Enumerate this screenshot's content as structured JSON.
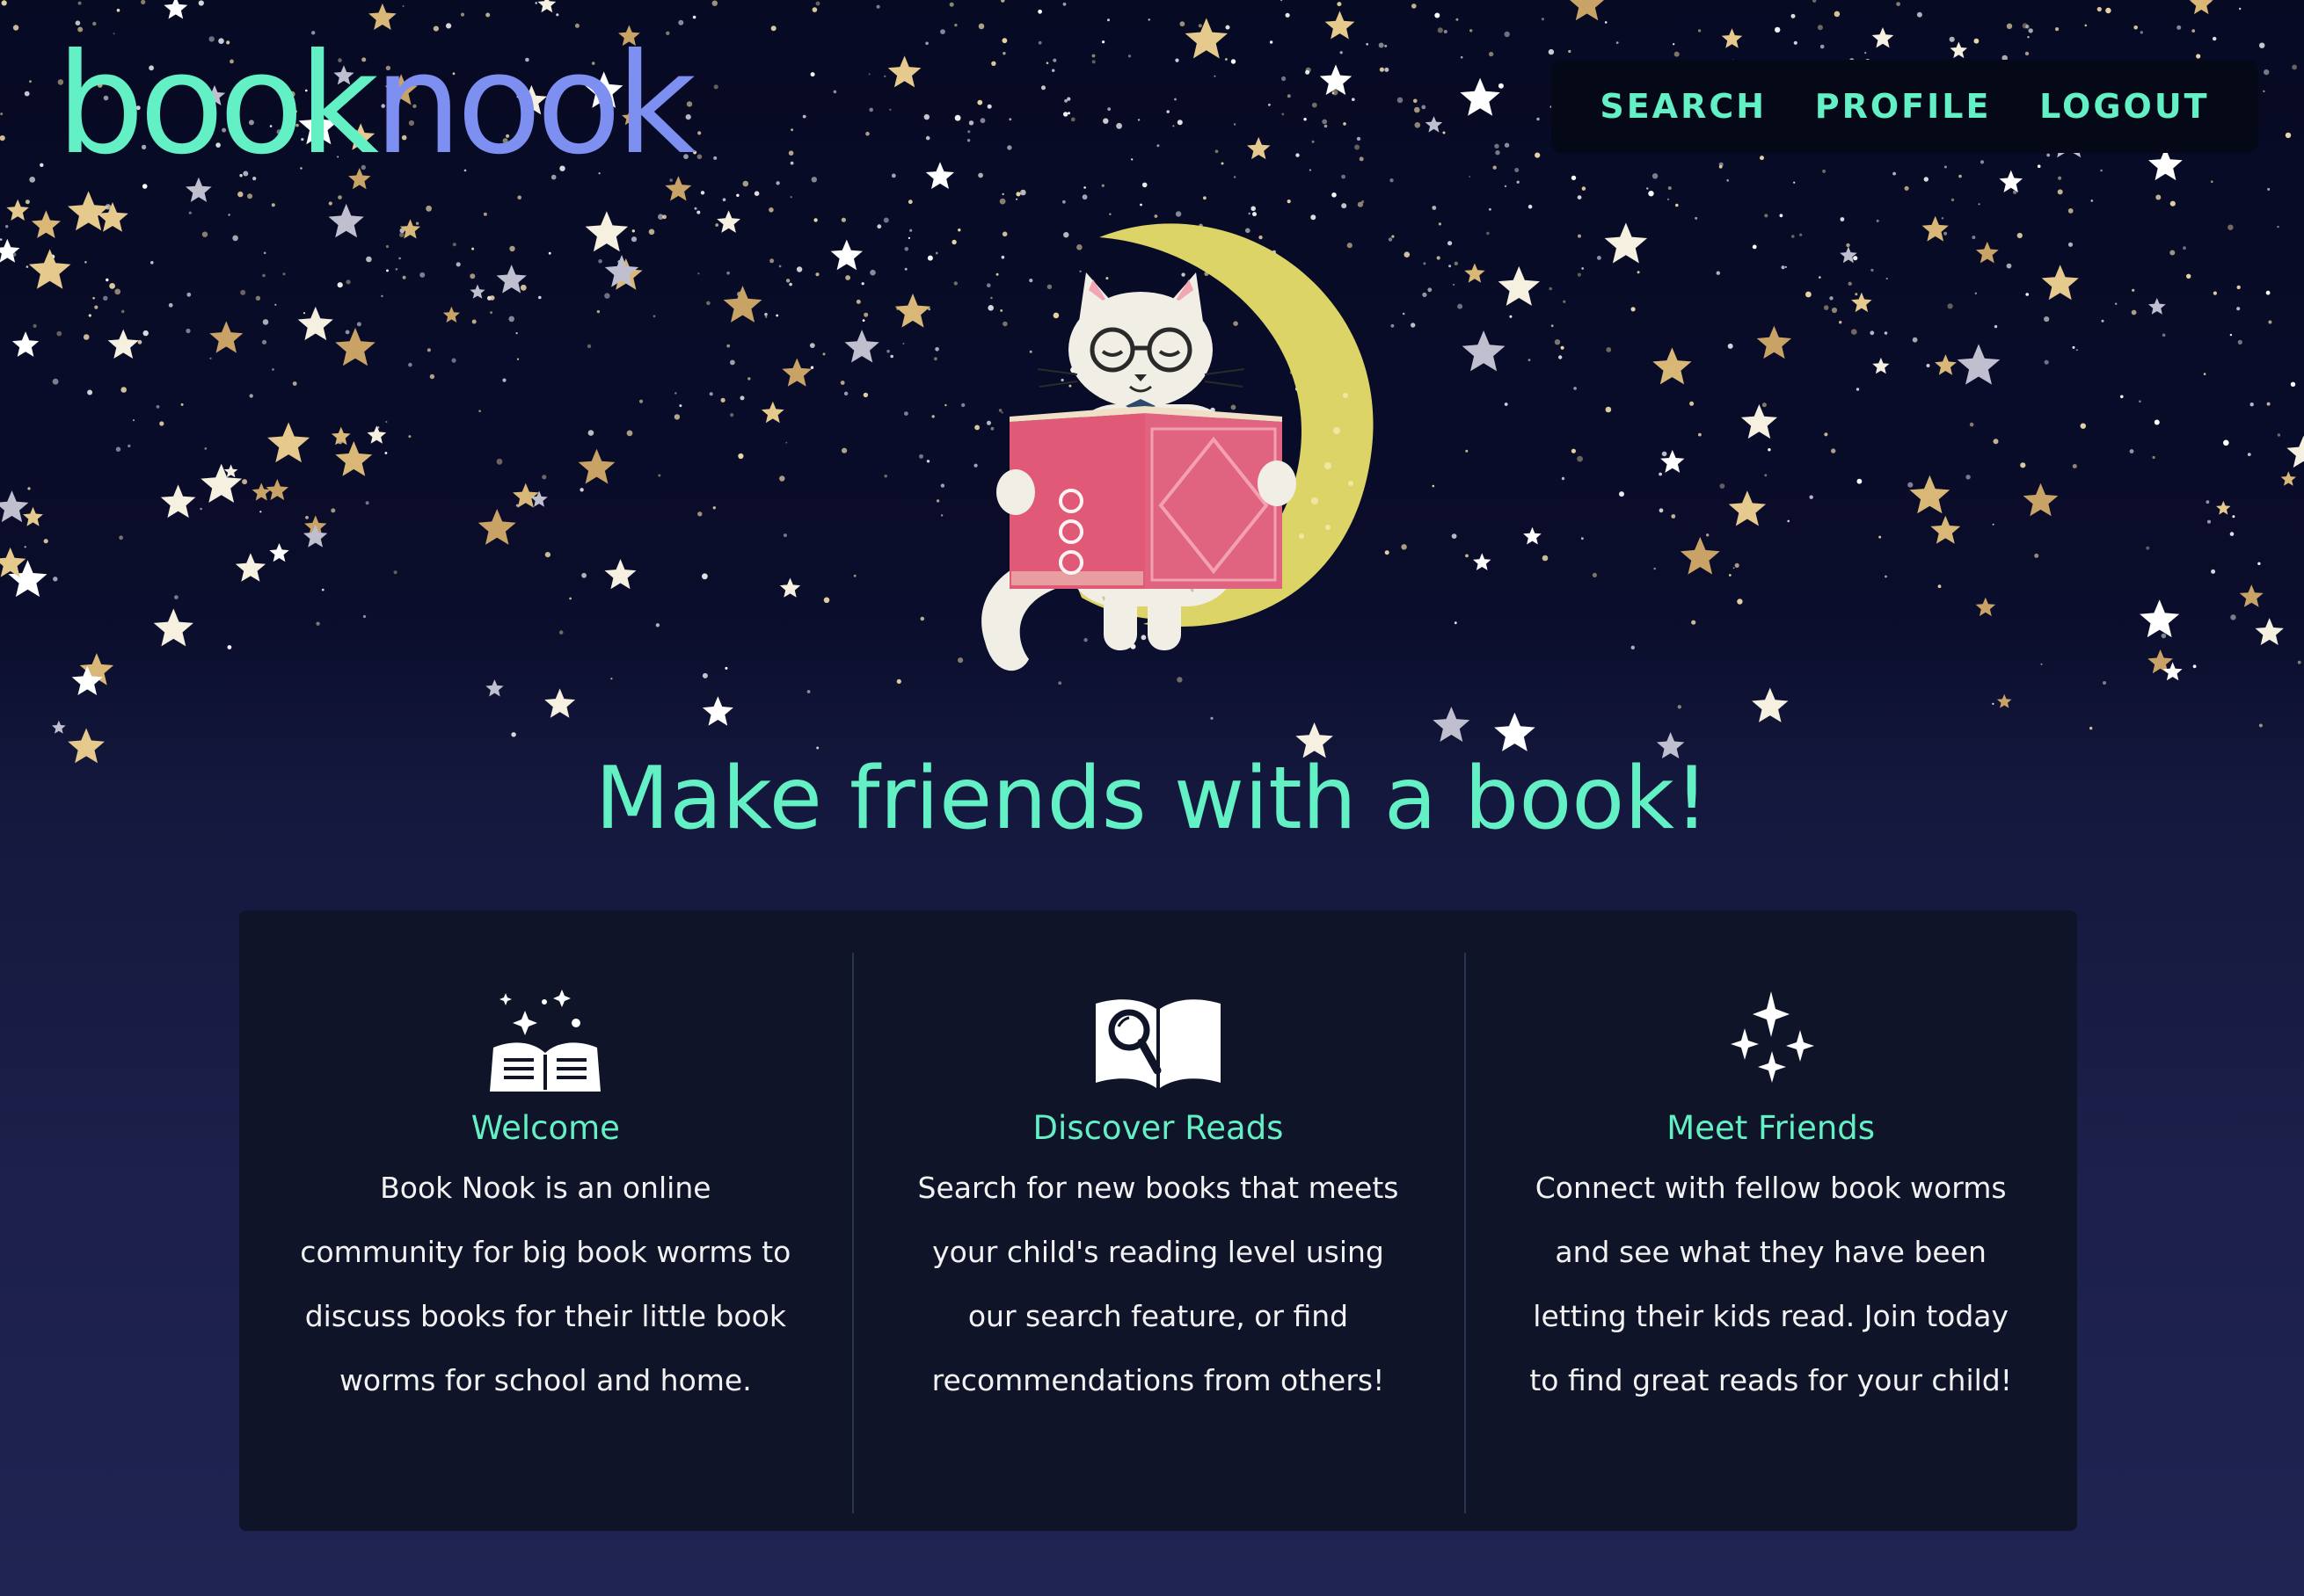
{
  "header": {
    "logo_part1": "book",
    "logo_part2": "nook",
    "nav": {
      "search": "SEARCH",
      "profile": "PROFILE",
      "logout": "LOGOUT"
    }
  },
  "hero": {
    "tagline": "Make friends with a book!"
  },
  "features": {
    "welcome": {
      "title": "Welcome",
      "text": "Book Nook is an online community for big book worms to discuss books for their little book worms for school and home."
    },
    "discover": {
      "title": "Discover Reads",
      "text": "Search for new books that meets your child's reading level using our search feature, or find recommendations from others!"
    },
    "friends": {
      "title": "Meet Friends",
      "text": "Connect with fellow book worms and see what they have been letting their kids read. Join today to find great reads for your child!"
    }
  },
  "colors": {
    "accent": "#62f0c4",
    "logo_secondary": "#7e8ff2",
    "night_sky": "#070a23",
    "card_bg": "#0f1429",
    "book_red": "#e05a78",
    "moon": "#ddd468",
    "star_gold": "#d9b877"
  },
  "icons": {
    "welcome": "open-book-sparkle-icon",
    "discover": "book-magnifier-icon",
    "friends": "sparkles-icon"
  }
}
